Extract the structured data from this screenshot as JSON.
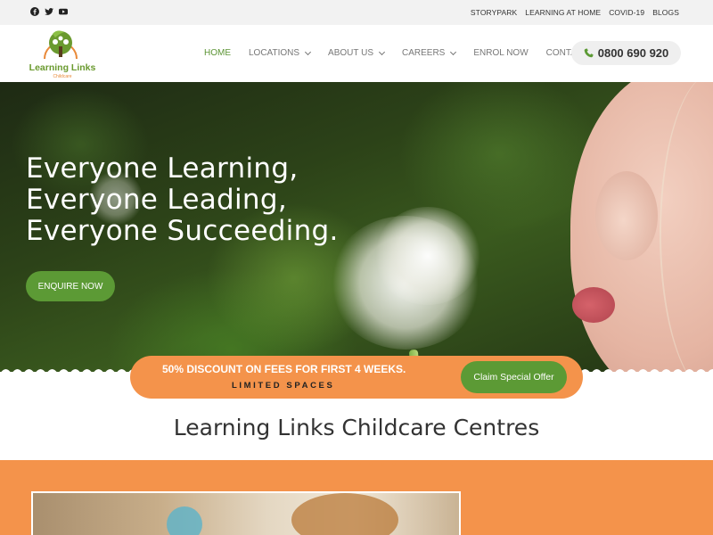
{
  "social": {
    "icons": [
      "facebook-icon",
      "twitter-icon",
      "youtube-icon"
    ]
  },
  "toplinks": [
    "STORYPARK",
    "LEARNING AT HOME",
    "COVID-19",
    "BLOGS"
  ],
  "logo": {
    "name": "Learning Links",
    "sub": "Childcare"
  },
  "nav": {
    "home": "HOME",
    "locations": "LOCATIONS",
    "about": "ABOUT US",
    "careers": "CAREERS",
    "enrol": "ENROL NOW",
    "contact": "CONTACT"
  },
  "phone": {
    "number": "0800 690 920",
    "icon": "phone-icon"
  },
  "hero": {
    "line1": "Everyone Learning,",
    "line2": "Everyone Leading,",
    "line3": "Everyone Succeeding.",
    "cta": "ENQUIRE NOW"
  },
  "offer": {
    "line1": "50% DISCOUNT ON FEES FOR FIRST 4 WEEKS.",
    "line2": "LIMITED SPACES",
    "button": "Claim Special Offer"
  },
  "section": {
    "title": "Learning Links Childcare Centres"
  },
  "colors": {
    "accent_green": "#5c9a35",
    "accent_orange": "#f4934b",
    "nav_active": "#5c9435"
  }
}
